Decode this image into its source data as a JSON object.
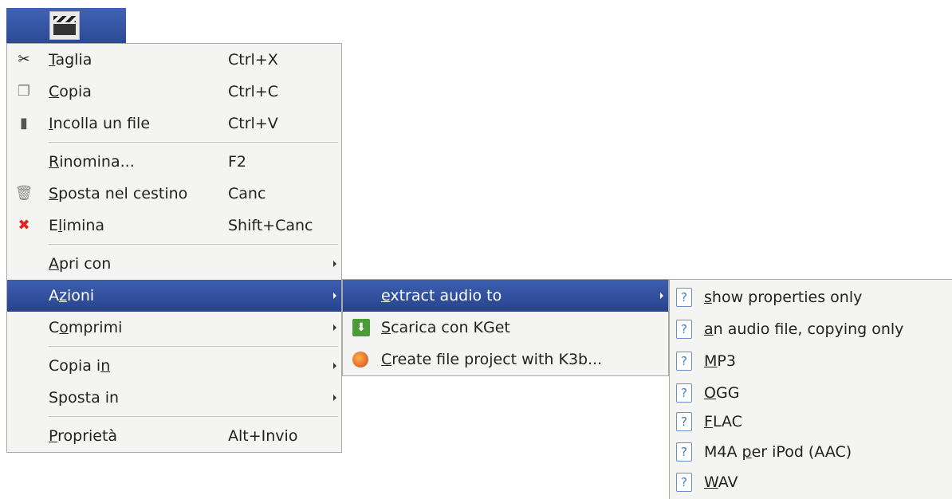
{
  "main_menu": {
    "items": [
      {
        "label": "Taglia",
        "mnemonic": "T",
        "shortcut": "Ctrl+X",
        "icon": "scissors-icon"
      },
      {
        "label": "Copia",
        "mnemonic": "C",
        "shortcut": "Ctrl+C",
        "icon": "copy-icon"
      },
      {
        "label": "Incolla un file",
        "mnemonic": "I",
        "shortcut": "Ctrl+V",
        "icon": "paste-icon"
      },
      {
        "label": "Rinomina...",
        "mnemonic": "R",
        "shortcut": "F2"
      },
      {
        "label": "Sposta nel cestino",
        "mnemonic": "S",
        "shortcut": "Canc",
        "icon": "trash-icon"
      },
      {
        "label": "Elimina",
        "mnemonic": "l",
        "shortcut": "Shift+Canc",
        "icon": "delete-icon"
      },
      {
        "label": "Apri con",
        "mnemonic": "A",
        "submenu": true
      },
      {
        "label": "Azioni",
        "mnemonic": "z",
        "submenu": true,
        "highlighted": true
      },
      {
        "label": "Comprimi",
        "mnemonic": "o",
        "submenu": true
      },
      {
        "label": "Copia in",
        "mnemonic": "n",
        "submenu": true
      },
      {
        "label": "Sposta in",
        "submenu": true
      },
      {
        "label": "Proprietà",
        "mnemonic": "P",
        "shortcut": "Alt+Invio"
      }
    ]
  },
  "azioni_menu": {
    "items": [
      {
        "label": "extract audio to",
        "mnemonic": "e",
        "submenu": true,
        "highlighted": true
      },
      {
        "label": "Scarica con KGet",
        "mnemonic": "S",
        "icon": "kget-icon"
      },
      {
        "label": "Create file project with K3b...",
        "mnemonic": "C",
        "icon": "k3b-icon"
      }
    ]
  },
  "extract_menu": {
    "items": [
      {
        "label": "show properties only",
        "mnemonic": "s",
        "icon": "unknown-action-icon"
      },
      {
        "label": "an audio file, copying only",
        "mnemonic": "a",
        "icon": "unknown-action-icon"
      },
      {
        "label": "MP3",
        "mnemonic": "M",
        "icon": "unknown-action-icon"
      },
      {
        "label": "OGG",
        "mnemonic": "O",
        "icon": "unknown-action-icon"
      },
      {
        "label": "FLAC",
        "mnemonic": "F",
        "icon": "unknown-action-icon"
      },
      {
        "label": "M4A per iPod (AAC)",
        "mnemonic": "p",
        "icon": "unknown-action-icon"
      },
      {
        "label": "WAV",
        "mnemonic": "W",
        "icon": "unknown-action-icon"
      }
    ]
  },
  "colors": {
    "highlight": "#3d5fb0",
    "menu_bg": "#f4f4f2",
    "icon_tab": "#2c4a93"
  }
}
